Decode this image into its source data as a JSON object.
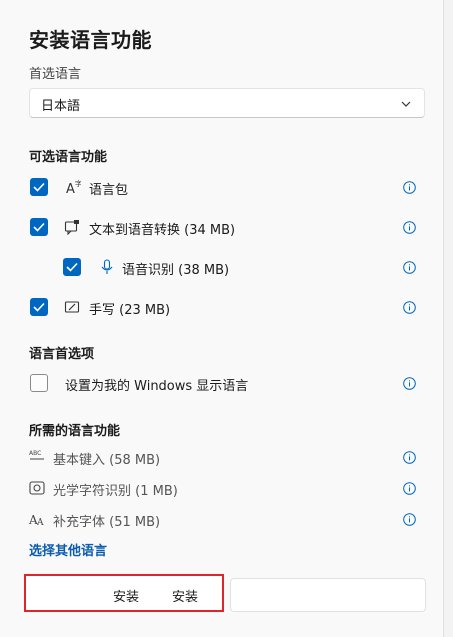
{
  "title": "安装语言功能",
  "preferred_language_label": "首选语言",
  "preferred_language_value": "日本語",
  "optional_features": {
    "heading": "可选语言功能",
    "items": [
      {
        "label": "语言包",
        "checked": true
      },
      {
        "label": "文本到语音转换 (34 MB)",
        "checked": true
      },
      {
        "label": "语音识别 (38 MB)",
        "checked": true
      },
      {
        "label": "手写 (23 MB)",
        "checked": true
      }
    ]
  },
  "preferences": {
    "heading": "语言首选项",
    "items": [
      {
        "label": "设置为我的 Windows 显示语言",
        "checked": false
      }
    ]
  },
  "required_features": {
    "heading": "所需的语言功能",
    "items": [
      {
        "label": "基本键入 (58 MB)"
      },
      {
        "label": "光学字符识别 (1 MB)"
      },
      {
        "label": "补充字体 (51 MB)"
      }
    ]
  },
  "choose_other_link": "选择其他语言",
  "footer": {
    "install_label_1": "安装",
    "install_label_2": "安装"
  },
  "colors": {
    "accent": "#0067c0",
    "highlight": "#e0252a"
  }
}
